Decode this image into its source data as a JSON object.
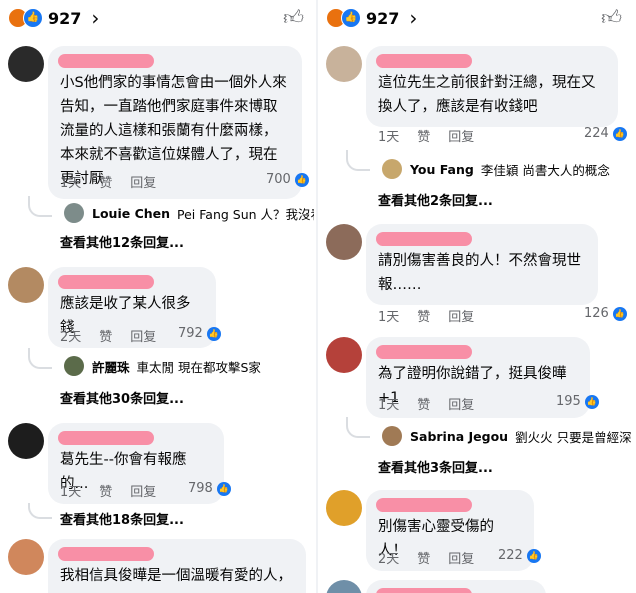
{
  "left": {
    "reaction_count": "927",
    "comments": [
      {
        "text": "小S他們家的事情怎會由一個外人來告知，一直踏他們家庭事件來博取流量的人這樣和張蘭有什麼兩樣，本來就不喜歡這位媒體人了，現在更討厭",
        "time": "1天",
        "like": "赞",
        "reply": "回复",
        "likes": "700",
        "reply_preview": {
          "name": "Louie Chen",
          "text": "Pei Fang Sun 人？我沒看..."
        },
        "more": "查看其他12条回复..."
      },
      {
        "text": "應該是收了某人很多錢",
        "time": "2天",
        "like": "赞",
        "reply": "回复",
        "likes": "792",
        "reply_preview": {
          "name": "許麗珠",
          "text": "車太閒 現在都攻擊S家"
        },
        "more": "查看其他30条回复..."
      },
      {
        "text": "葛先生--你會有報應的...",
        "time": "1天",
        "like": "赞",
        "reply": "回复",
        "likes": "798",
        "more": "查看其他18条回复..."
      },
      {
        "text": "我相信具俊曄是一個溫暖有愛的人，"
      }
    ]
  },
  "right": {
    "reaction_count": "927",
    "comments": [
      {
        "text": "這位先生之前很針對汪總，現在又換人了，應該是有收錢吧",
        "time": "1天",
        "like": "赞",
        "reply": "回复",
        "likes": "224",
        "reply_preview": {
          "name": "You Fang",
          "text": "李佳穎 尚書大人的概念"
        },
        "more": "查看其他2条回复..."
      },
      {
        "text": "請別傷害善良的人！不然會現世報……",
        "time": "1天",
        "like": "赞",
        "reply": "回复",
        "likes": "126"
      },
      {
        "text": "為了證明你說錯了，挺具俊曄+1",
        "time": "1天",
        "like": "赞",
        "reply": "回复",
        "likes": "195",
        "reply_preview": {
          "name": "Sabrina Jegou",
          "text": "劉火火 只要是曾經深情..."
        },
        "more": "查看其他3条回复..."
      },
      {
        "text": "別傷害心靈受傷的人！",
        "time": "2天",
        "like": "赞",
        "reply": "回复",
        "likes": "222"
      }
    ]
  }
}
